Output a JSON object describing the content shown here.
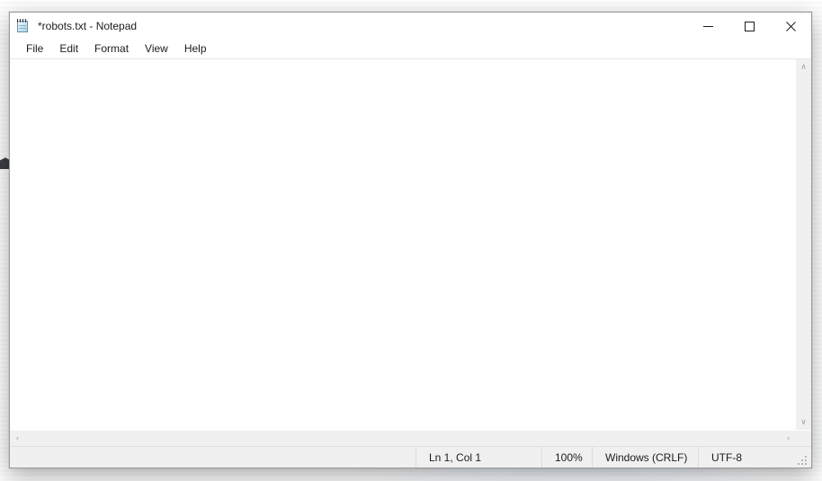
{
  "desktop": {
    "name": "windows-desktop-wallpaper"
  },
  "window": {
    "title": "*robots.txt - Notepad",
    "app_icon": "notepad-icon",
    "controls": {
      "minimize": "Minimize",
      "maximize": "Maximize",
      "close": "Close"
    }
  },
  "menubar": {
    "items": [
      {
        "label": "File"
      },
      {
        "label": "Edit"
      },
      {
        "label": "Format"
      },
      {
        "label": "View"
      },
      {
        "label": "Help"
      }
    ]
  },
  "editor": {
    "content": "",
    "placeholder": ""
  },
  "scrollbars": {
    "vertical": {
      "up_arrow": "∧",
      "down_arrow": "∨"
    },
    "horizontal": {
      "left_arrow": "‹",
      "right_arrow": "›"
    }
  },
  "statusbar": {
    "position": "Ln 1, Col 1",
    "zoom": "100%",
    "line_ending": "Windows (CRLF)",
    "encoding": "UTF-8"
  },
  "colors": {
    "window_bg": "#ffffff",
    "chrome_bg": "#f0f0f0",
    "text": "#1c1c1c",
    "border": "#9b9b9b",
    "close_hover": "#e81123",
    "menu_hover": "#cde8ff"
  }
}
